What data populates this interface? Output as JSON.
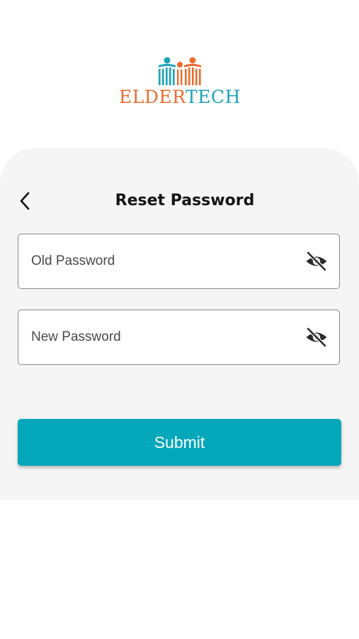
{
  "brand": {
    "logo_text_a": "ELDER",
    "logo_text_b": "TECH",
    "colors": {
      "orange": "#ec6b2d",
      "teal": "#1aa3b8"
    }
  },
  "header": {
    "back_icon": "chevron-left-icon",
    "title": "Reset Password"
  },
  "form": {
    "old_password": {
      "placeholder": "Old Password",
      "value": "",
      "toggle_icon": "eye-off-icon"
    },
    "new_password": {
      "placeholder": "New Password",
      "value": "",
      "toggle_icon": "eye-off-icon"
    },
    "submit_label": "Submit"
  },
  "theme": {
    "accent": "#05a7bb",
    "card_bg": "#f5f5f5"
  }
}
